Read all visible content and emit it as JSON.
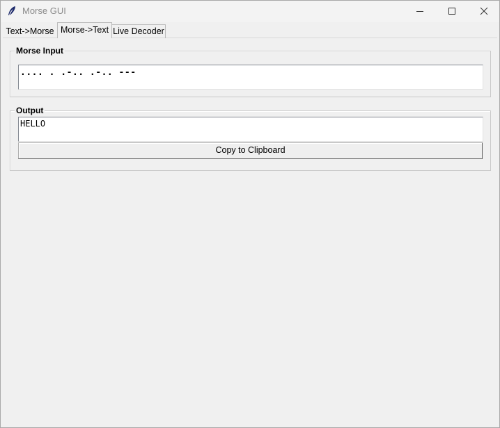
{
  "window": {
    "title": "Morse GUI",
    "icon": "feather-icon",
    "controls": [
      "minimize-icon",
      "maximize-icon",
      "close-icon"
    ]
  },
  "tabs": [
    {
      "label": "Text->Morse",
      "selected": false
    },
    {
      "label": "Morse->Text",
      "selected": true
    },
    {
      "label": "Live Decoder",
      "selected": false
    }
  ],
  "morse_input": {
    "label": "Morse Input",
    "value": ".... . .-.. .-.. ---"
  },
  "output": {
    "label": "Output",
    "value": "HELLO",
    "copy_button_label": "Copy to Clipboard"
  },
  "colors": {
    "background": "#f0f0f0",
    "textbox_bg": "#ffffff",
    "title_text": "#8a8a8a"
  }
}
